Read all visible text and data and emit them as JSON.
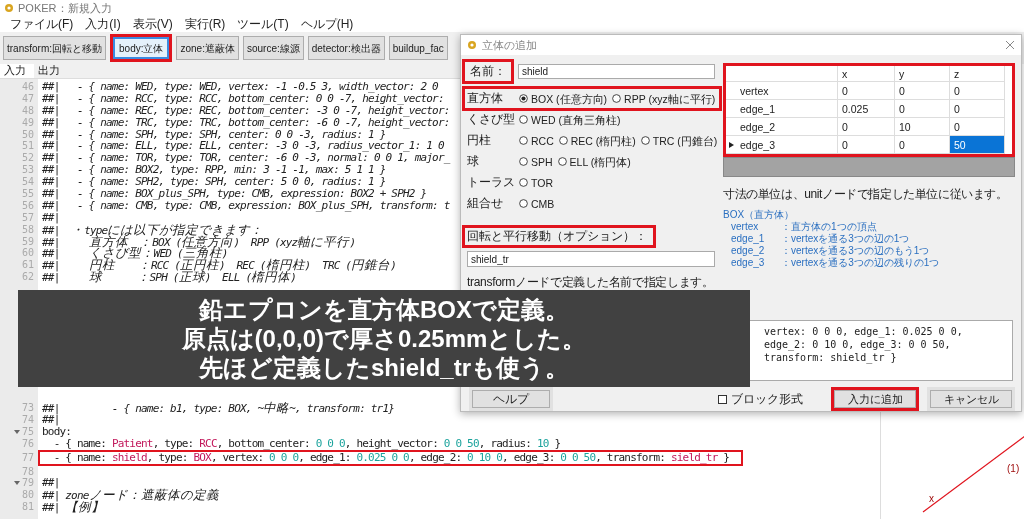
{
  "window": {
    "title": "POKER：新規入力"
  },
  "menu": [
    "ファイル(F)",
    "入力(I)",
    "表示(V)",
    "実行(R)",
    "ツール(T)",
    "ヘルプ(H)"
  ],
  "toolbar": [
    {
      "label": "transform:回転と移動",
      "highlighted": false,
      "focused": false
    },
    {
      "label": "body:立体",
      "highlighted": true,
      "focused": true
    },
    {
      "label": "zone:遮蔽体",
      "highlighted": false,
      "focused": false
    },
    {
      "label": "source:線源",
      "highlighted": false,
      "focused": false
    },
    {
      "label": "detector:検出器",
      "highlighted": false,
      "focused": false
    },
    {
      "label": "buildup_fac",
      "highlighted": false,
      "focused": false
    }
  ],
  "tabs": [
    {
      "label": "入力",
      "selected": true
    },
    {
      "label": "出力",
      "selected": false
    }
  ],
  "editor": {
    "lines": [
      {
        "number": "46",
        "kind": "comment",
        "text": "##|   - { name: WED, type: WED, vertex: -1 -0.5 3, width_vector: 2 0"
      },
      {
        "number": "47",
        "kind": "comment",
        "text": "##|   - { name: RCC, type: RCC, bottom_center: 0 0 -7, height_vector:"
      },
      {
        "number": "48",
        "kind": "comment",
        "text": "##|   - { name: REC, type: REC, bottom_center: -3 0 -7, height_vector:"
      },
      {
        "number": "49",
        "kind": "comment",
        "text": "##|   - { name: TRC, type: TRC, bottom_center: -6 0 -7, height_vector:"
      },
      {
        "number": "50",
        "kind": "comment",
        "text": "##|   - { name: SPH, type: SPH, center: 0 0 -3, radius: 1 }"
      },
      {
        "number": "51",
        "kind": "comment",
        "text": "##|   - { name: ELL, type: ELL, center: -3 0 -3, radius_vector_1: 1 0"
      },
      {
        "number": "52",
        "kind": "comment",
        "text": "##|   - { name: TOR, type: TOR, center: -6 0 -3, normal: 0 0 1, major_"
      },
      {
        "number": "53",
        "kind": "comment",
        "text": "##|   - { name: BOX2, type: RPP, min: 3 -1 -1, max: 5 1 1 }"
      },
      {
        "number": "54",
        "kind": "comment",
        "text": "##|   - { name: SPH2, type: SPH, center: 5 0 0, radius: 1 }"
      },
      {
        "number": "55",
        "kind": "comment",
        "text": "##|   - { name: BOX_plus_SPH, type: CMB, expression: BOX2 + SPH2 }"
      },
      {
        "number": "56",
        "kind": "comment",
        "text": "##|   - { name: CMB, type: CMB, expression: BOX_plus_SPH, transform: t"
      },
      {
        "number": "57",
        "kind": "comment",
        "text": "##|"
      },
      {
        "number": "58",
        "kind": "comment",
        "text": "##|  ・typeには以下が指定できます："
      },
      {
        "number": "59",
        "kind": "comment",
        "text": "##|     直方体  ：BOX (任意方向)  RPP (xyz軸に平行)"
      },
      {
        "number": "60",
        "kind": "comment",
        "text": "##|     くさび型：WED (三角柱)"
      },
      {
        "number": "61",
        "kind": "comment",
        "text": "##|     円柱    ：RCC (正円柱)  REC (楕円柱)  TRC (円錐台)"
      },
      {
        "number": "62",
        "kind": "comment",
        "text": "##|     球      ：SPH (正球)  ELL (楕円体)"
      },
      {
        "number": "73",
        "kind": "comment",
        "text": "##|         - { name: b1, type: BOX, ~中略~, transform: tr1}"
      },
      {
        "number": "74",
        "kind": "comment",
        "text": "##|"
      },
      {
        "number": "75",
        "kind": "code",
        "foldable": true,
        "text": "body:"
      },
      {
        "number": "76",
        "kind": "code",
        "segments": [
          {
            "kind": "plain",
            "text": "  - { name: "
          },
          {
            "kind": "name",
            "text": "Patient"
          },
          {
            "kind": "plain",
            "text": ", type: "
          },
          {
            "kind": "name",
            "text": "RCC"
          },
          {
            "kind": "plain",
            "text": ", bottom_center: "
          },
          {
            "kind": "number",
            "text": "0 0 0"
          },
          {
            "kind": "plain",
            "text": ", height_vector: "
          },
          {
            "kind": "number",
            "text": "0 0 50"
          },
          {
            "kind": "plain",
            "text": ", radius: "
          },
          {
            "kind": "number",
            "text": "10"
          },
          {
            "kind": "plain",
            "text": " }"
          }
        ]
      },
      {
        "number": "77",
        "kind": "code",
        "highlighted": true,
        "segments": [
          {
            "kind": "plain",
            "text": "  - { name: "
          },
          {
            "kind": "name",
            "text": "shield"
          },
          {
            "kind": "plain",
            "text": ", type: "
          },
          {
            "kind": "name",
            "text": "BOX"
          },
          {
            "kind": "plain",
            "text": ", vertex: "
          },
          {
            "kind": "number",
            "text": "0 0 0"
          },
          {
            "kind": "plain",
            "text": ", edge_1: "
          },
          {
            "kind": "number",
            "text": "0.025 0 0"
          },
          {
            "kind": "plain",
            "text": ", edge_2: "
          },
          {
            "kind": "number",
            "text": "0 10 0"
          },
          {
            "kind": "plain",
            "text": ", edge_3: "
          },
          {
            "kind": "number",
            "text": "0 0 50"
          },
          {
            "kind": "plain",
            "text": ", transform: "
          },
          {
            "kind": "name",
            "text": "sield_tr"
          },
          {
            "kind": "plain",
            "text": " }"
          }
        ]
      },
      {
        "number": "78"
      },
      {
        "number": "79",
        "kind": "comment",
        "foldable": true,
        "text": "##|"
      },
      {
        "number": "80",
        "kind": "comment",
        "text": "##| zoneノード：遮蔽体の定義"
      },
      {
        "number": "81",
        "kind": "comment",
        "text": "##| 【例】"
      }
    ]
  },
  "view": {
    "labels": [
      "(1)",
      "x"
    ]
  },
  "dialog": {
    "title": "立体の追加",
    "name_field": {
      "label": "名前：",
      "value": "shield",
      "highlighted": true
    },
    "shape_groups": [
      {
        "label": "直方体",
        "highlighted": true,
        "options": [
          {
            "label": "BOX (任意方向)",
            "selected": true
          },
          {
            "label": "RPP (xyz軸に平行)",
            "selected": false
          }
        ]
      },
      {
        "label": "くさび型",
        "highlighted": false,
        "options": [
          {
            "label": "WED (直角三角柱)",
            "selected": false
          }
        ]
      },
      {
        "label": "円柱",
        "highlighted": false,
        "options": [
          {
            "label": "RCC",
            "selected": false
          },
          {
            "label": "REC (楕円柱)",
            "selected": false
          },
          {
            "label": "TRC (円錐台)",
            "selected": false
          }
        ]
      },
      {
        "label": "球",
        "highlighted": false,
        "options": [
          {
            "label": "SPH",
            "selected": false
          },
          {
            "label": "ELL (楕円体)",
            "selected": false
          }
        ]
      },
      {
        "label": "トーラス",
        "highlighted": false,
        "options": [
          {
            "label": "TOR",
            "selected": false
          }
        ]
      },
      {
        "label": "組合せ",
        "highlighted": false,
        "options": [
          {
            "label": "CMB",
            "selected": false
          }
        ]
      }
    ],
    "transform_field": {
      "label": "回転と平行移動（オプション）：",
      "value": "shield_tr",
      "hint": "transformノードで定義した名前で指定します。",
      "highlighted": true
    },
    "table": {
      "highlighted": true,
      "columns": [
        "x",
        "y",
        "z"
      ],
      "rows": [
        {
          "name": "vertex",
          "current": false,
          "cells": [
            {
              "text": "0",
              "selected": false
            },
            {
              "text": "0",
              "selected": false
            },
            {
              "text": "0",
              "selected": false
            }
          ]
        },
        {
          "name": "edge_1",
          "current": false,
          "cells": [
            {
              "text": "0.025",
              "selected": false
            },
            {
              "text": "0",
              "selected": false
            },
            {
              "text": "0",
              "selected": false
            }
          ]
        },
        {
          "name": "edge_2",
          "current": false,
          "cells": [
            {
              "text": "0",
              "selected": false
            },
            {
              "text": "10",
              "selected": false
            },
            {
              "text": "0",
              "selected": false
            }
          ]
        },
        {
          "name": "edge_3",
          "current": true,
          "cells": [
            {
              "text": "0",
              "selected": false
            },
            {
              "text": "0",
              "selected": false
            },
            {
              "text": "50",
              "selected": true
            }
          ]
        }
      ]
    },
    "unit_note": "寸法の単位は、unitノードで指定した単位に従います。",
    "help_heading": "BOX（直方体）",
    "help_lines": [
      {
        "term": "vertex",
        "desc": "：直方体の1つの頂点"
      },
      {
        "term": "edge_1",
        "desc": "：vertexを通る3つの辺の1つ"
      },
      {
        "term": "edge_2",
        "desc": "：vertexを通る3つの辺のもう1つ"
      },
      {
        "term": "edge_3",
        "desc": "：vertexを通る3つの辺の残りの1つ"
      }
    ],
    "preview": "vertex: 0 0 0, edge_1: 0.025 0 0, edge_2: 0 10 0, edge_3: 0 0 50, transform: shield_tr }",
    "help_button": "ヘルプ",
    "block_checkbox": {
      "label": "ブロック形式",
      "checked": false
    },
    "buttons": [
      {
        "label": "入力に追加",
        "highlighted": true
      },
      {
        "label": "キャンセル",
        "highlighted": false
      }
    ]
  },
  "caption": [
    "鉛エプロンを直方体BOXで定義。",
    "原点は(0,0,0)で厚さ0.25mmとした。",
    "先ほど定義したshield_trも使う。"
  ]
}
